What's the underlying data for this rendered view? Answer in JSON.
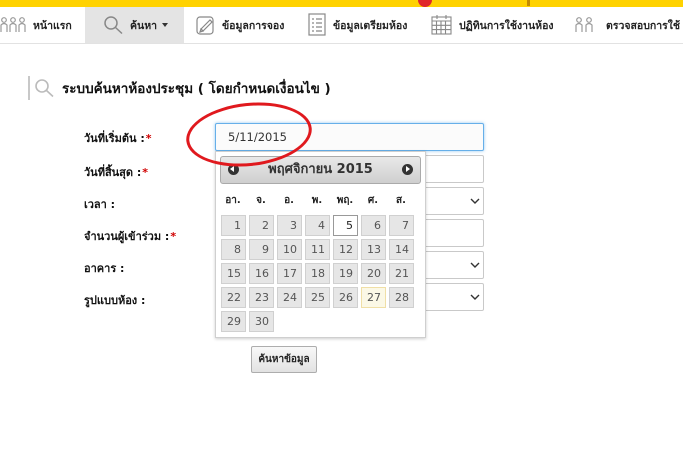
{
  "nav": {
    "items": [
      {
        "label": "หน้าแรก",
        "icon": "home-icon"
      },
      {
        "label": "ค้นหา",
        "icon": "search-icon",
        "active": true
      },
      {
        "label": "ข้อมูลการจอง",
        "icon": "edit-icon"
      },
      {
        "label": "ข้อมูลเตรียมห้อง",
        "icon": "list-icon"
      },
      {
        "label": "ปฏิทินการใช้งานห้อง",
        "icon": "calendar-icon"
      },
      {
        "label": "ตรวจสอบการใช้",
        "icon": "people-icon"
      }
    ]
  },
  "page": {
    "title": "ระบบค้นหาห้องประชุม ( โดยกำหนดเงื่อนไข )"
  },
  "form": {
    "start_date": {
      "label": "วันที่เริ่มต้น :",
      "required": "*",
      "value": "5/11/2015"
    },
    "end_date": {
      "label": "วันที่สิ้นสุด :",
      "required": "*"
    },
    "time": {
      "label": "เวลา :"
    },
    "attendees": {
      "label": "จำนวนผู้เข้าร่วม :",
      "required": "*"
    },
    "building": {
      "label": "อาคาร :"
    },
    "room_type": {
      "label": "รูปแบบห้อง :"
    },
    "search_button": "ค้นหาข้อมูล"
  },
  "datepicker": {
    "title": "พฤศจิกายน 2015",
    "weekdays": [
      "อา.",
      "จ.",
      "อ.",
      "พ.",
      "พฤ.",
      "ศ.",
      "ส."
    ],
    "days": [
      "1",
      "2",
      "3",
      "4",
      "5",
      "6",
      "7",
      "8",
      "9",
      "10",
      "11",
      "12",
      "13",
      "14",
      "15",
      "16",
      "17",
      "18",
      "19",
      "20",
      "21",
      "22",
      "23",
      "24",
      "25",
      "26",
      "27",
      "28",
      "29",
      "30"
    ],
    "selected_day": "5",
    "highlighted_day": "27"
  },
  "colors": {
    "annotation_circle": "#e0191e",
    "top_strip": "#ffd200",
    "required": "#d00000"
  }
}
